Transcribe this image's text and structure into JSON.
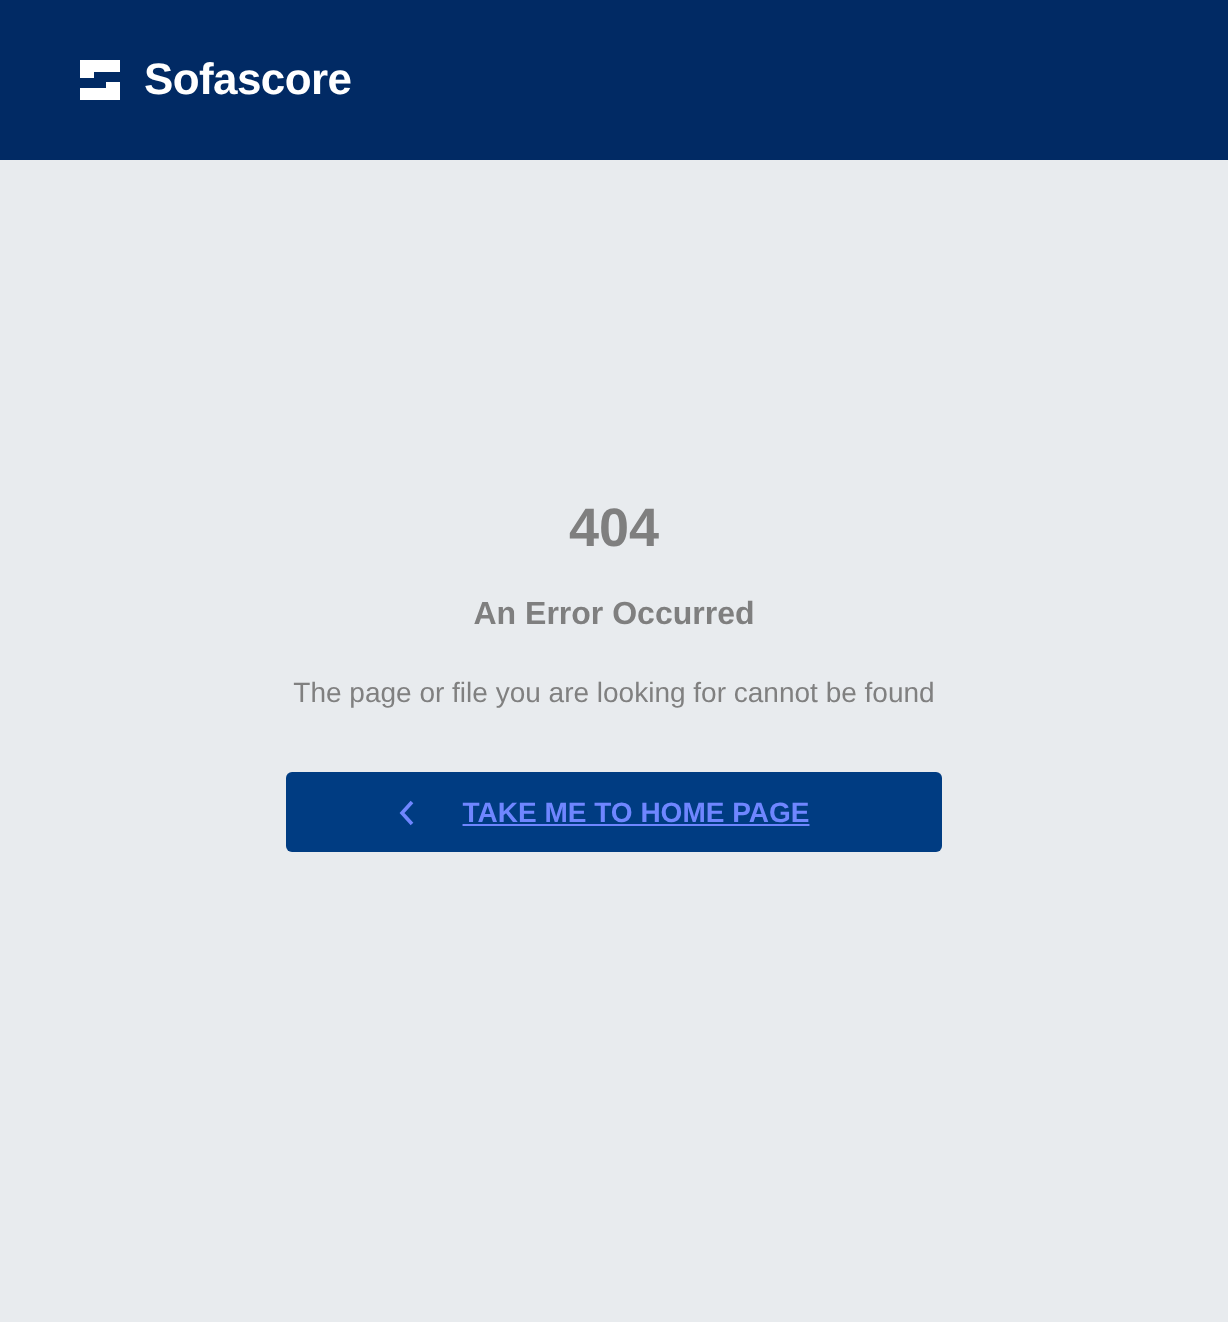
{
  "header": {
    "logo_text": "Sofascore"
  },
  "error": {
    "code": "404",
    "title": "An Error Occurred",
    "message": "The page or file you are looking for cannot be found"
  },
  "home_button": {
    "label": "TAKE ME TO HOME PAGE"
  }
}
